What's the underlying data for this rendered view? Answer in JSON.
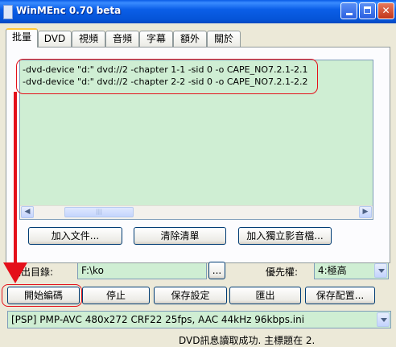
{
  "window": {
    "title": "WinMEnc 0.70 beta"
  },
  "tabs": [
    {
      "label": "批量",
      "active": true
    },
    {
      "label": "DVD"
    },
    {
      "label": "視頻"
    },
    {
      "label": "音頻"
    },
    {
      "label": "字幕"
    },
    {
      "label": "額外"
    },
    {
      "label": "關於"
    }
  ],
  "batch_list": {
    "lines": [
      "-dvd-device \"d:\" dvd://2 -chapter 1-1 -sid 0 -o CAPE_NO7.2.1-2.1",
      "-dvd-device \"d:\" dvd://2 -chapter 2-2 -sid 0 -o CAPE_NO7.2.1-2.2"
    ]
  },
  "list_buttons": {
    "add_file": "加入文件...",
    "clear_list": "清除清單",
    "add_standalone": "加入獨立影音檔..."
  },
  "output": {
    "label": "輸出目錄:",
    "value": "F:\\ko",
    "browse": "..."
  },
  "priority": {
    "label": "優先權:",
    "value": "4:極高"
  },
  "actions": {
    "start": "開始編碼",
    "stop": "停止",
    "save_settings": "保存設定",
    "export": "匯出",
    "save_config": "保存配置..."
  },
  "profile": {
    "value": "[PSP] PMP-AVC 480x272 CRF22 25fps, AAC 44kHz 96kbps.ini"
  },
  "status": {
    "text": "DVD訊息讀取成功. 主標題在 2."
  },
  "colors": {
    "field_bg": "#cfeed3",
    "annotation": "#e4101a",
    "titlebar": "#0b5fe8"
  }
}
